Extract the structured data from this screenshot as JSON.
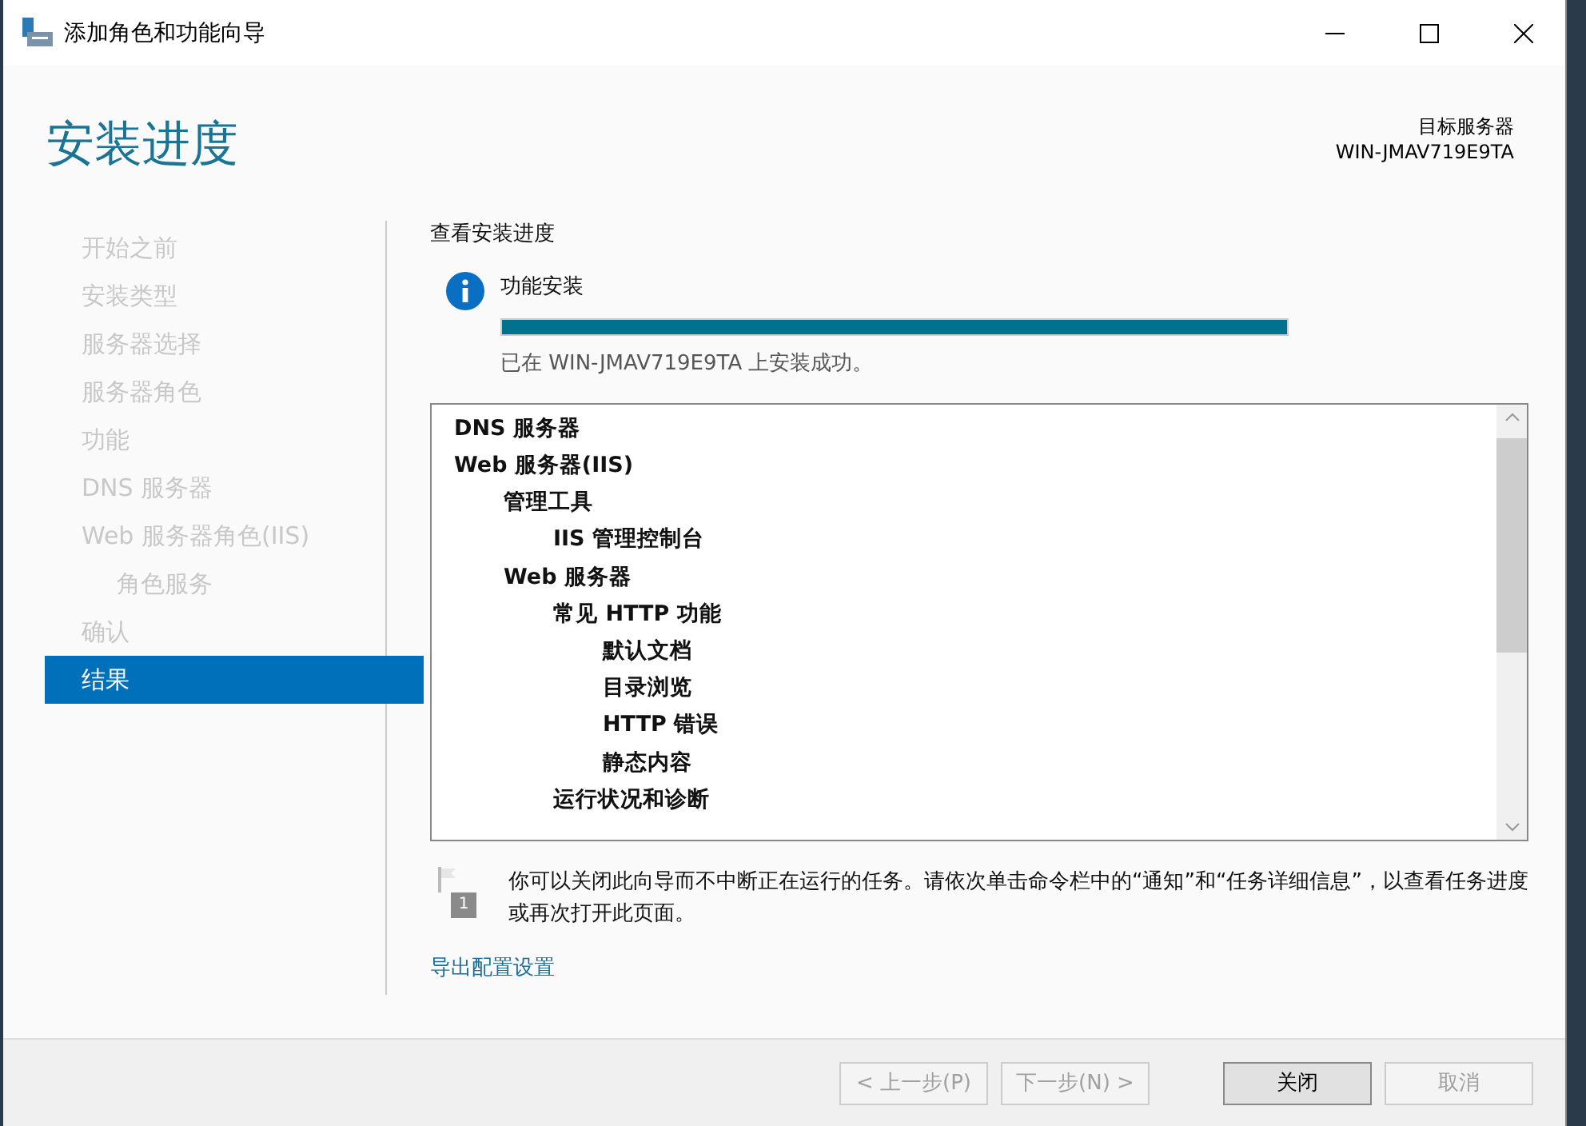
{
  "window": {
    "title": "添加角色和功能向导"
  },
  "page": {
    "heading": "安装进度",
    "target_label": "目标服务器",
    "target_server": "WIN-JMAV719E9TA"
  },
  "sidebar": {
    "items": [
      {
        "label": "开始之前",
        "selected": false
      },
      {
        "label": "安装类型",
        "selected": false
      },
      {
        "label": "服务器选择",
        "selected": false
      },
      {
        "label": "服务器角色",
        "selected": false
      },
      {
        "label": "功能",
        "selected": false
      },
      {
        "label": "DNS 服务器",
        "selected": false
      },
      {
        "label": "Web 服务器角色(IIS)",
        "selected": false,
        "children": [
          {
            "label": "角色服务",
            "selected": false
          }
        ]
      },
      {
        "label": "确认",
        "selected": false
      },
      {
        "label": "结果",
        "selected": true
      }
    ]
  },
  "progress": {
    "section_title": "查看安装进度",
    "task": "功能安装",
    "level": 1,
    "status": "已在 WIN-JMAV719E9TA 上安装成功。"
  },
  "results": {
    "items": [
      {
        "label": "DNS 服务器"
      },
      {
        "label": "Web 服务器(IIS)",
        "children": [
          {
            "label": "管理工具",
            "children": [
              {
                "label": "IIS 管理控制台"
              }
            ]
          },
          {
            "label": "Web 服务器",
            "children": [
              {
                "label": "常见 HTTP 功能",
                "children": [
                  {
                    "label": "默认文档"
                  },
                  {
                    "label": "目录浏览"
                  },
                  {
                    "label": "HTTP 错误"
                  },
                  {
                    "label": "静态内容"
                  }
                ]
              },
              {
                "label": "运行状况和诊断"
              }
            ]
          }
        ]
      }
    ]
  },
  "notice": {
    "badge": "1",
    "text": "你可以关闭此向导而不中断正在运行的任务。请依次单击命令栏中的“通知”和“任务详细信息”，以查看任务进度或再次打开此页面。"
  },
  "export_link": "导出配置设置",
  "buttons": [
    {
      "label": "< 上一步(P)",
      "disabled": true
    },
    {
      "label": "下一步(N) >",
      "disabled": true
    },
    {
      "label": "关闭",
      "disabled": false
    },
    {
      "label": "取消",
      "disabled": true
    }
  ]
}
